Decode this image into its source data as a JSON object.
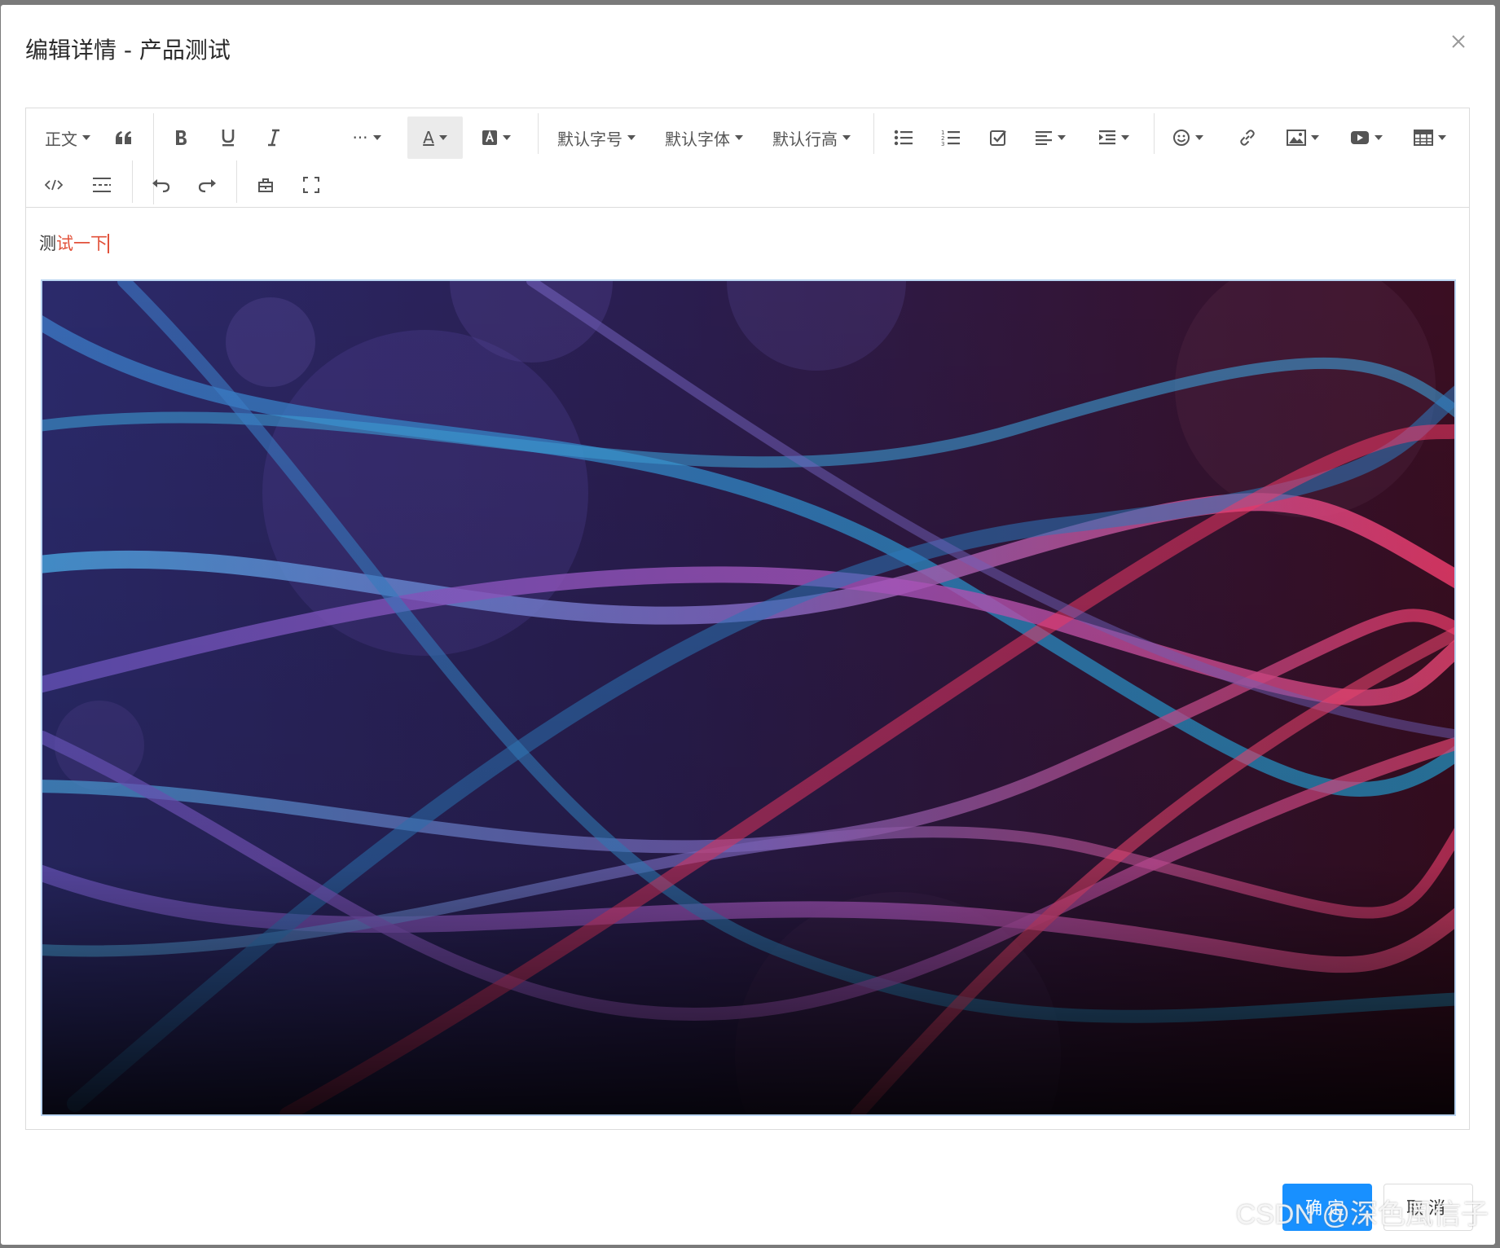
{
  "dialog": {
    "title": "编辑详情 - 产品测试"
  },
  "toolbar": {
    "heading_label": "正文",
    "font_size_label": "默认字号",
    "font_family_label": "默认字体",
    "line_height_label": "默认行高",
    "more_label": "···",
    "font_color_label": "A"
  },
  "content": {
    "text_part1": "测",
    "text_part2": "试一下",
    "text_color": "#e2513a"
  },
  "footer": {
    "ok_label": "确定",
    "cancel_label": "取消",
    "primary_color": "#1890ff"
  },
  "watermark": "CSDN @深色風信子"
}
